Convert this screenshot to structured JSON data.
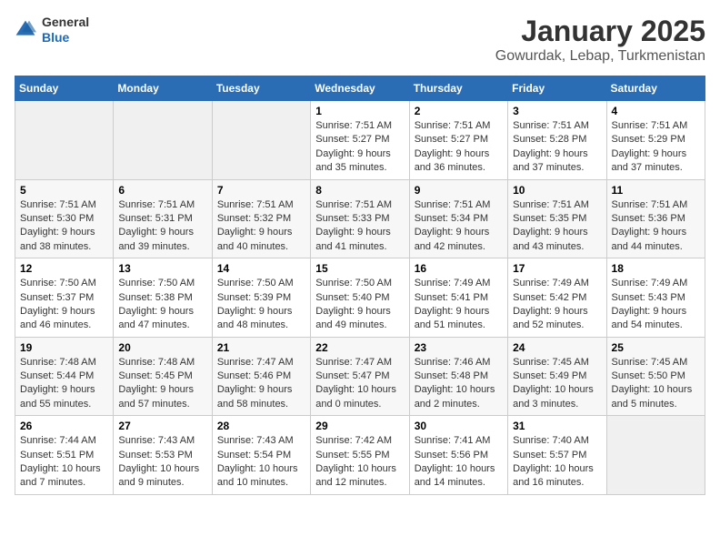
{
  "header": {
    "logo": {
      "general": "General",
      "blue": "Blue"
    },
    "title": "January 2025",
    "subtitle": "Gowurdak, Lebap, Turkmenistan"
  },
  "calendar": {
    "weekdays": [
      "Sunday",
      "Monday",
      "Tuesday",
      "Wednesday",
      "Thursday",
      "Friday",
      "Saturday"
    ],
    "weeks": [
      [
        {
          "day": "",
          "info": ""
        },
        {
          "day": "",
          "info": ""
        },
        {
          "day": "",
          "info": ""
        },
        {
          "day": "1",
          "info": "Sunrise: 7:51 AM\nSunset: 5:27 PM\nDaylight: 9 hours and 35 minutes."
        },
        {
          "day": "2",
          "info": "Sunrise: 7:51 AM\nSunset: 5:27 PM\nDaylight: 9 hours and 36 minutes."
        },
        {
          "day": "3",
          "info": "Sunrise: 7:51 AM\nSunset: 5:28 PM\nDaylight: 9 hours and 37 minutes."
        },
        {
          "day": "4",
          "info": "Sunrise: 7:51 AM\nSunset: 5:29 PM\nDaylight: 9 hours and 37 minutes."
        }
      ],
      [
        {
          "day": "5",
          "info": "Sunrise: 7:51 AM\nSunset: 5:30 PM\nDaylight: 9 hours and 38 minutes."
        },
        {
          "day": "6",
          "info": "Sunrise: 7:51 AM\nSunset: 5:31 PM\nDaylight: 9 hours and 39 minutes."
        },
        {
          "day": "7",
          "info": "Sunrise: 7:51 AM\nSunset: 5:32 PM\nDaylight: 9 hours and 40 minutes."
        },
        {
          "day": "8",
          "info": "Sunrise: 7:51 AM\nSunset: 5:33 PM\nDaylight: 9 hours and 41 minutes."
        },
        {
          "day": "9",
          "info": "Sunrise: 7:51 AM\nSunset: 5:34 PM\nDaylight: 9 hours and 42 minutes."
        },
        {
          "day": "10",
          "info": "Sunrise: 7:51 AM\nSunset: 5:35 PM\nDaylight: 9 hours and 43 minutes."
        },
        {
          "day": "11",
          "info": "Sunrise: 7:51 AM\nSunset: 5:36 PM\nDaylight: 9 hours and 44 minutes."
        }
      ],
      [
        {
          "day": "12",
          "info": "Sunrise: 7:50 AM\nSunset: 5:37 PM\nDaylight: 9 hours and 46 minutes."
        },
        {
          "day": "13",
          "info": "Sunrise: 7:50 AM\nSunset: 5:38 PM\nDaylight: 9 hours and 47 minutes."
        },
        {
          "day": "14",
          "info": "Sunrise: 7:50 AM\nSunset: 5:39 PM\nDaylight: 9 hours and 48 minutes."
        },
        {
          "day": "15",
          "info": "Sunrise: 7:50 AM\nSunset: 5:40 PM\nDaylight: 9 hours and 49 minutes."
        },
        {
          "day": "16",
          "info": "Sunrise: 7:49 AM\nSunset: 5:41 PM\nDaylight: 9 hours and 51 minutes."
        },
        {
          "day": "17",
          "info": "Sunrise: 7:49 AM\nSunset: 5:42 PM\nDaylight: 9 hours and 52 minutes."
        },
        {
          "day": "18",
          "info": "Sunrise: 7:49 AM\nSunset: 5:43 PM\nDaylight: 9 hours and 54 minutes."
        }
      ],
      [
        {
          "day": "19",
          "info": "Sunrise: 7:48 AM\nSunset: 5:44 PM\nDaylight: 9 hours and 55 minutes."
        },
        {
          "day": "20",
          "info": "Sunrise: 7:48 AM\nSunset: 5:45 PM\nDaylight: 9 hours and 57 minutes."
        },
        {
          "day": "21",
          "info": "Sunrise: 7:47 AM\nSunset: 5:46 PM\nDaylight: 9 hours and 58 minutes."
        },
        {
          "day": "22",
          "info": "Sunrise: 7:47 AM\nSunset: 5:47 PM\nDaylight: 10 hours and 0 minutes."
        },
        {
          "day": "23",
          "info": "Sunrise: 7:46 AM\nSunset: 5:48 PM\nDaylight: 10 hours and 2 minutes."
        },
        {
          "day": "24",
          "info": "Sunrise: 7:45 AM\nSunset: 5:49 PM\nDaylight: 10 hours and 3 minutes."
        },
        {
          "day": "25",
          "info": "Sunrise: 7:45 AM\nSunset: 5:50 PM\nDaylight: 10 hours and 5 minutes."
        }
      ],
      [
        {
          "day": "26",
          "info": "Sunrise: 7:44 AM\nSunset: 5:51 PM\nDaylight: 10 hours and 7 minutes."
        },
        {
          "day": "27",
          "info": "Sunrise: 7:43 AM\nSunset: 5:53 PM\nDaylight: 10 hours and 9 minutes."
        },
        {
          "day": "28",
          "info": "Sunrise: 7:43 AM\nSunset: 5:54 PM\nDaylight: 10 hours and 10 minutes."
        },
        {
          "day": "29",
          "info": "Sunrise: 7:42 AM\nSunset: 5:55 PM\nDaylight: 10 hours and 12 minutes."
        },
        {
          "day": "30",
          "info": "Sunrise: 7:41 AM\nSunset: 5:56 PM\nDaylight: 10 hours and 14 minutes."
        },
        {
          "day": "31",
          "info": "Sunrise: 7:40 AM\nSunset: 5:57 PM\nDaylight: 10 hours and 16 minutes."
        },
        {
          "day": "",
          "info": ""
        }
      ]
    ]
  }
}
